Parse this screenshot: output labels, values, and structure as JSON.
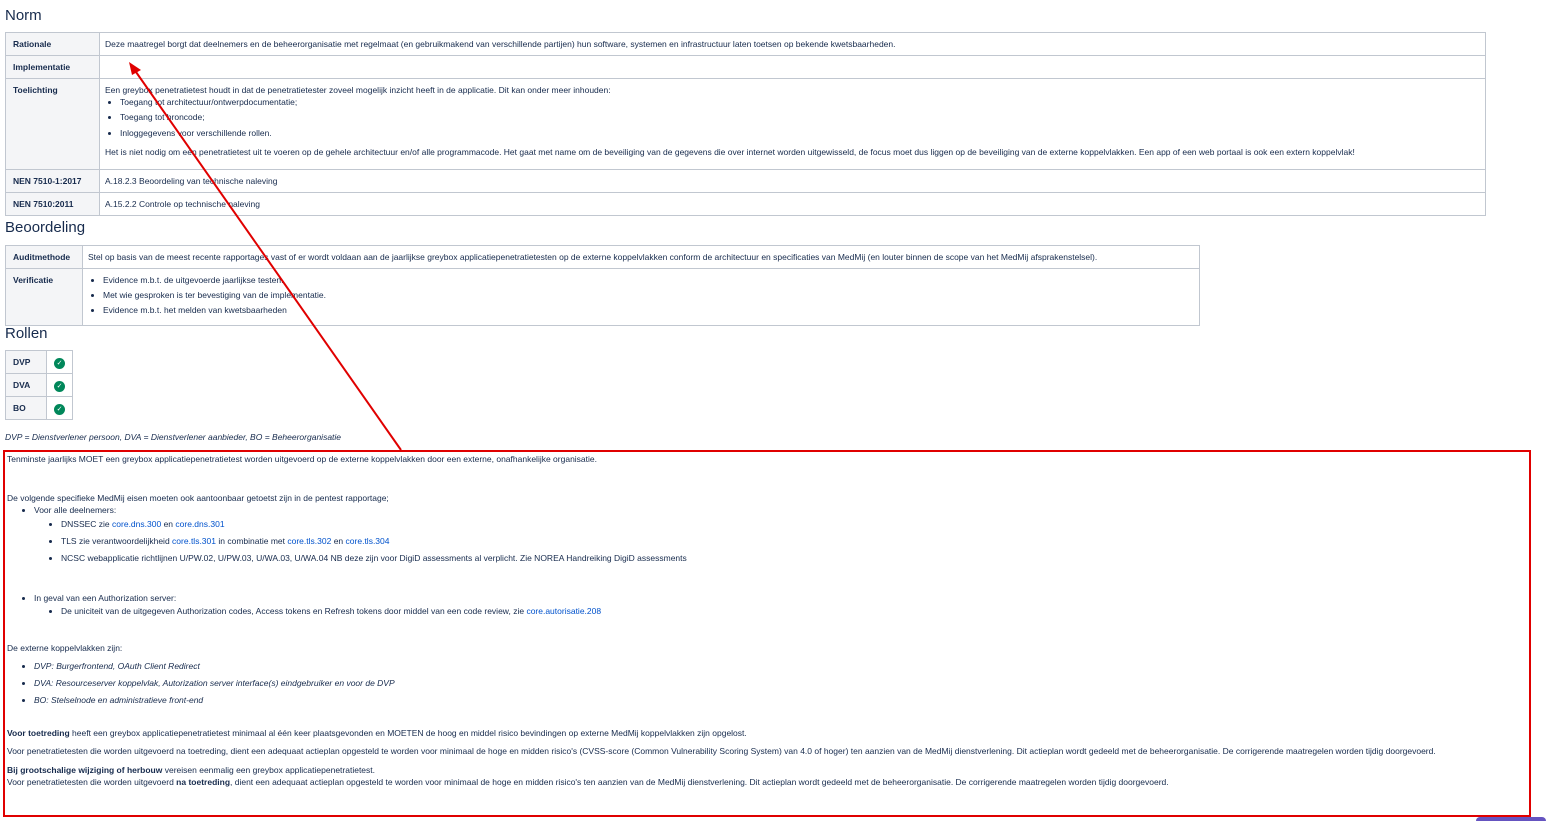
{
  "norm": {
    "heading": "Norm",
    "rows": [
      {
        "label": "Rationale",
        "text": "Deze maatregel borgt dat deelnemers en de beheerorganisatie met regelmaat (en gebruikmakend van verschillende partijen) hun software, systemen en infrastructuur laten toetsen op bekende kwetsbaarheden."
      },
      {
        "label": "Implementatie",
        "text": ""
      },
      {
        "label": "Toelichting",
        "intro": "Een greybox penetratietest houdt in dat de penetratietester zoveel mogelijk inzicht heeft in de applicatie. Dit kan onder meer inhouden:",
        "bullets": [
          "Toegang tot architectuur/ontwerpdocumentatie;",
          "Toegang tot broncode;",
          "Inloggegevens voor verschillende rollen."
        ],
        "outro": "Het is niet nodig om een penetratietest uit te voeren op de gehele architectuur en/of alle programmacode. Het gaat met name om de beveiliging van de gegevens die over internet worden uitgewisseld, de focus moet dus liggen op de beveiliging van de externe koppelvlakken. Een app of een web portaal is ook een extern koppelvlak!"
      },
      {
        "label": "NEN 7510-1:2017",
        "text": "A.18.2.3 Beoordeling van technische naleving"
      },
      {
        "label": "NEN 7510:2011",
        "text": "A.15.2.2 Controle op technische naleving"
      }
    ]
  },
  "beoordeling": {
    "heading": "Beoordeling",
    "auditmethode_label": "Auditmethode",
    "auditmethode_text": "Stel op basis van de meest recente rapportages vast of er wordt voldaan aan de jaarlijkse greybox applicatiepenetratietesten op de externe koppelvlakken conform de architectuur en specificaties van MedMij (en louter binnen de scope van het MedMij afsprakenstelsel).",
    "verificatie_label": "Verificatie",
    "verificatie_bullets": [
      "Evidence m.b.t. de uitgevoerde jaarlijkse testen.",
      "Met wie gesproken is ter bevestiging van de implementatie.",
      "Evidence m.b.t. het melden van kwetsbaarheden"
    ]
  },
  "rollen": {
    "heading": "Rollen",
    "items": [
      {
        "label": "DVP",
        "check": "✓"
      },
      {
        "label": "DVA",
        "check": "✓"
      },
      {
        "label": "BO",
        "check": "✓"
      }
    ],
    "legend": "DVP = Dienstverlener persoon, DVA = Dienstverlener aanbieder, BO = Beheerorganisatie"
  },
  "annotation": {
    "p1": "Tenminste jaarlijks MOET een greybox applicatiepenetratietest worden uitgevoerd op de externe koppelvlakken door een externe, onafhankelijke organisatie.",
    "p2": "De volgende specifieke MedMij eisen moeten ook aantoonbaar getoetst zijn in de pentest rapportage;",
    "all_participants": "Voor alle deelnemers:",
    "dnssec_prefix": "DNSSEC zie",
    "dnssec_link1": "core.dns.300",
    "dnssec_and": "en",
    "dnssec_link2": "core.dns.301",
    "tls_prefix": "TLS zie verantwoordelijkheid",
    "tls_link1": "core.tls.301",
    "tls_mid": "in combinatie met",
    "tls_link2": "core.tls.302",
    "tls_and": "en",
    "tls_link3": "core.tls.304",
    "ncsc": "NCSC webapplicatie richtlijnen U/PW.02, U/PW.03, U/WA.03, U/WA.04 NB deze zijn voor DigiD assessments al verplicht. Zie NOREA Handreiking DigiD assessments",
    "auth_server": "In geval van een Authorization server:",
    "auth_text": "De uniciteit van de uitgegeven Authorization codes, Access tokens en Refresh tokens door middel van een code review, zie",
    "auth_link": "core.autorisatie.208",
    "koppel_heading": "De externe koppelvlakken zijn:",
    "koppel": [
      "DVP: Burgerfrontend, OAuth Client Redirect",
      "DVA: Resourceserver koppelvlak, Autorization server interface(s) eindgebruiker en voor de DVP",
      "BO:  Stelselnode en administratieve front-end"
    ],
    "p_toetreding_bold": "Voor toetreding",
    "p_toetreding_rest": " heeft een greybox applicatiepenetratietest minimaal al één keer plaatsgevonden en MOETEN de hoog en middel risico bevindingen op externe MedMij koppelvlakken zijn opgelost.",
    "p_na_toetreding": "Voor penetratietesten die worden uitgevoerd na toetreding, dient een adequaat actieplan opgesteld te worden voor minimaal de hoge en midden risico's (CVSS-score (Common Vulnerability Scoring System) van 4.0 of hoger) ten aanzien van de MedMij dienstverlening. Dit actieplan wordt gedeeld met de beheerorganisatie. De corrigerende maatregelen worden tijdig doorgevoerd.",
    "p_wijziging_bold": "Bij grootschalige wijziging of herbouw",
    "p_wijziging_rest": " vereisen eenmalig een greybox applicatiepenetratietest.",
    "p_last_pre": "Voor penetratietesten die worden uitgevoerd ",
    "p_last_bold": "na toetreding",
    "p_last_rest": ", dient een adequaat actieplan opgesteld te worden voor minimaal de hoge en midden risico's ten aanzien van de MedMij dienstverlening. Dit actieplan wordt gedeeld met de beheerorganisatie. De corrigerende maatregelen worden tijdig doorgevoerd."
  },
  "colors": {
    "annotation_red": "#e00000",
    "link_blue": "#0052cc",
    "check_green": "#00875a"
  }
}
